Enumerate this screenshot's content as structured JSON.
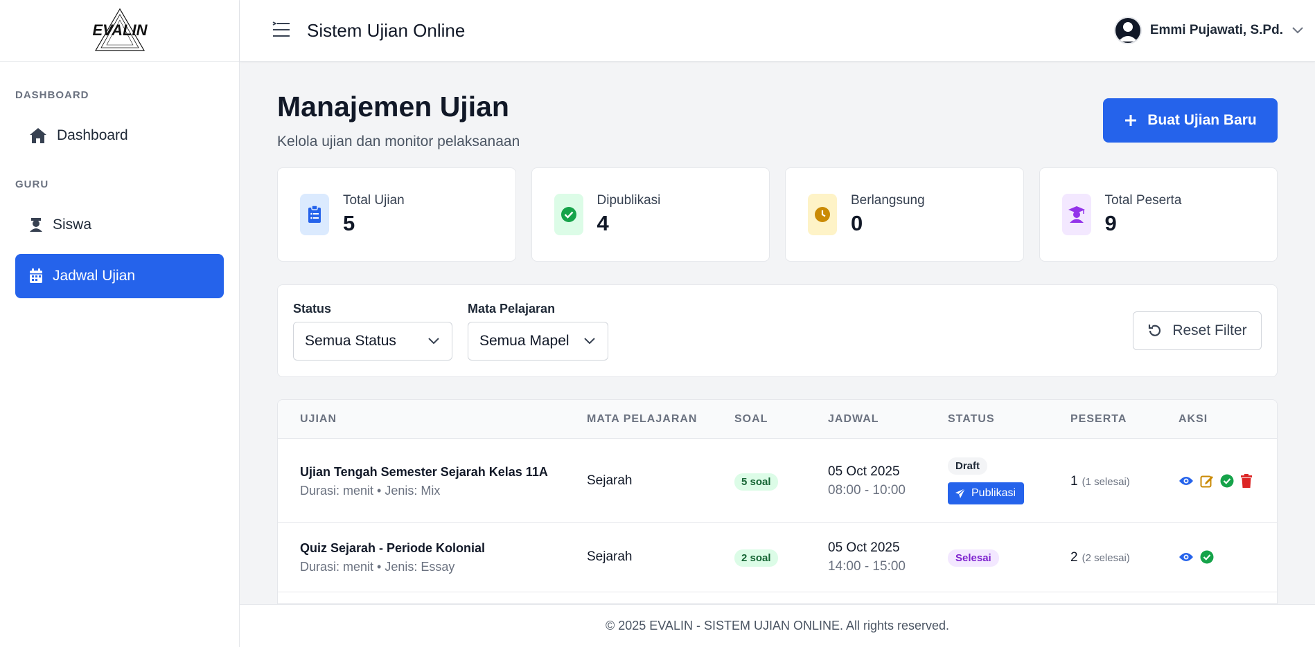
{
  "logo": {
    "text": "EVALIN"
  },
  "header": {
    "title": "Sistem Ujian Online",
    "user_name": "Emmi Pujawati, S.Pd."
  },
  "sidebar": {
    "sections": [
      {
        "label": "DASHBOARD",
        "items": [
          {
            "label": "Dashboard",
            "icon": "home-icon",
            "active": false
          }
        ]
      },
      {
        "label": "GURU",
        "items": [
          {
            "label": "Siswa",
            "icon": "student-icon",
            "active": false
          },
          {
            "label": "Jadwal Ujian",
            "icon": "calendar-icon",
            "active": true
          }
        ]
      }
    ]
  },
  "page": {
    "title": "Manajemen Ujian",
    "subtitle": "Kelola ujian dan monitor pelaksanaan",
    "create_button": "Buat Ujian Baru"
  },
  "stats": [
    {
      "label": "Total Ujian",
      "value": "5",
      "icon": "clipboard-icon",
      "color": "#2563eb",
      "bg": "#dbeafe"
    },
    {
      "label": "Dipublikasi",
      "value": "4",
      "icon": "check-circle-icon",
      "color": "#16a34a",
      "bg": "#dcfce7"
    },
    {
      "label": "Berlangsung",
      "value": "0",
      "icon": "clock-icon",
      "color": "#ca8a04",
      "bg": "#fef3c7"
    },
    {
      "label": "Total Peserta",
      "value": "9",
      "icon": "graduate-icon",
      "color": "#9333ea",
      "bg": "#f3e8ff"
    }
  ],
  "filters": {
    "status_label": "Status",
    "status_value": "Semua Status",
    "mapel_label": "Mata Pelajaran",
    "mapel_value": "Semua Mapel",
    "reset_label": "Reset Filter"
  },
  "table": {
    "headers": [
      "UJIAN",
      "MATA PELAJARAN",
      "SOAL",
      "JADWAL",
      "STATUS",
      "PESERTA",
      "AKSI"
    ],
    "rows": [
      {
        "name": "Ujian Tengah Semester Sejarah Kelas 11A",
        "meta": "Durasi: menit • Jenis: Mix",
        "subject": "Sejarah",
        "soal": "5 soal",
        "date": "05 Oct 2025",
        "time": "08:00 - 10:00",
        "status": "Draft",
        "publish_label": "Publikasi",
        "peserta": "1",
        "peserta_done": "(1 selesai)"
      },
      {
        "name": "Quiz Sejarah - Periode Kolonial",
        "meta": "Durasi: menit • Jenis: Essay",
        "subject": "Sejarah",
        "soal": "2 soal",
        "date": "05 Oct 2025",
        "time": "14:00 - 15:00",
        "status": "Selesai",
        "peserta": "2",
        "peserta_done": "(2 selesai)"
      }
    ]
  },
  "footer": {
    "text": "© 2025 EVALIN - SISTEM UJIAN ONLINE. All rights reserved."
  }
}
